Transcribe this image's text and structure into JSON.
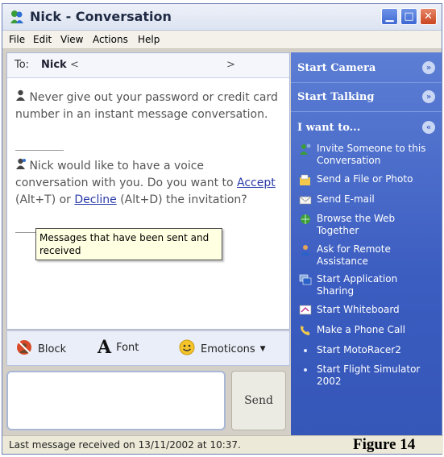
{
  "window": {
    "title": "Nick - Conversation"
  },
  "menu": [
    "File",
    "Edit",
    "View",
    "Actions",
    "Help"
  ],
  "to": {
    "label": "To:",
    "name": "Nick",
    "lt": "<",
    "gt": ">"
  },
  "messages": {
    "warning": "Never give out your password or credit card number in an instant message conversation.",
    "voice_prefix": "Nick would like to have a voice conversation with you. Do you want to",
    "accept": "Accept",
    "accept_key": "(Alt+T) or",
    "decline": "Decline",
    "decline_key": "(Alt+D) the invitation?"
  },
  "tooltip": "Messages that have been sent and received",
  "toolbar": {
    "block": "Block",
    "font": "Font",
    "emoticons": "Emoticons"
  },
  "send_label": "Send",
  "right": {
    "start_camera": "Start Camera",
    "start_talking": "Start Talking",
    "i_want_to": "I want to...",
    "tasks": [
      {
        "label": "Invite Someone to this Conversation",
        "icon": "invite-icon"
      },
      {
        "label": "Send a File or Photo",
        "icon": "file-icon"
      },
      {
        "label": "Send E-mail",
        "icon": "email-icon"
      },
      {
        "label": "Browse the Web Together",
        "icon": "browse-icon"
      },
      {
        "label": "Ask for Remote Assistance",
        "icon": "assistance-icon"
      },
      {
        "label": "Start Application Sharing",
        "icon": "sharing-icon"
      },
      {
        "label": "Start Whiteboard",
        "icon": "whiteboard-icon"
      },
      {
        "label": "Make a Phone Call",
        "icon": "phone-icon"
      },
      {
        "label": "Start MotoRacer2",
        "icon": "bullet-icon"
      },
      {
        "label": "Start Flight Simulator 2002",
        "icon": "bullet-icon"
      }
    ]
  },
  "status": "Last message received on 13/11/2002 at 10:37.",
  "figure_label": "Figure 14",
  "colors": {
    "task_pane": "#3b5cc0",
    "tooltip_bg": "#ffffe1",
    "link": "#2a3aa8"
  }
}
